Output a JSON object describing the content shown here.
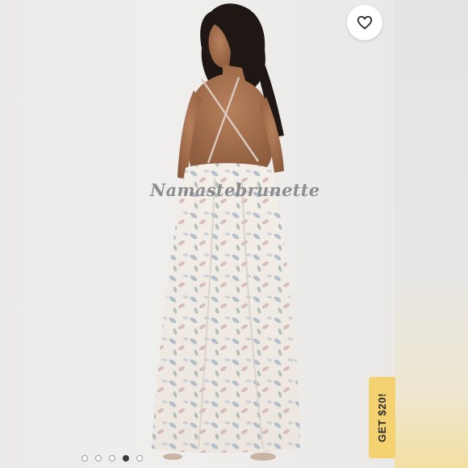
{
  "listing": {
    "watermark_text": "Namastebrunette",
    "photo_alt": "Model wearing a white floral print backless maxi dress"
  },
  "actions": {
    "like_icon": "heart-outline-icon"
  },
  "promo": {
    "label": "GET $20!",
    "color": "#f4d271"
  },
  "gallery": {
    "total_images": 5,
    "current_index": 4
  }
}
